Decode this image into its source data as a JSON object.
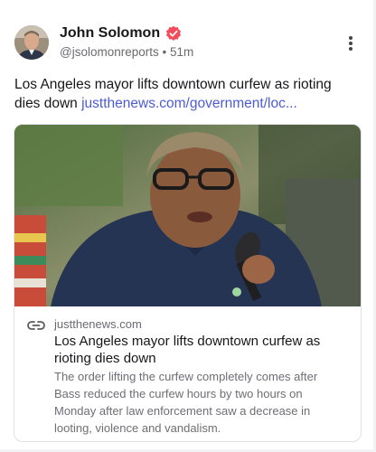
{
  "author": {
    "name": "John Solomon",
    "handle": "@jsolomonreports",
    "separator": " • ",
    "time": "51m"
  },
  "post": {
    "text": "Los Angeles mayor lifts downtown curfew as rioting dies down ",
    "link_text": "justthenews.com/government/loc..."
  },
  "link_card": {
    "domain": "justthenews.com",
    "title": "Los Angeles mayor lifts downtown curfew as rioting dies down",
    "description": "The order lifting the curfew completely comes after Bass reduced the curfew hours by two hours on Monday after law enforcement saw a decrease in looting, violence and vandalism."
  },
  "colors": {
    "verified_badge": "#f24b5b",
    "link": "#4c5bd4"
  },
  "icons": {
    "verified": "verified-badge-icon",
    "menu": "more-vertical-icon",
    "link": "link-chain-icon"
  }
}
